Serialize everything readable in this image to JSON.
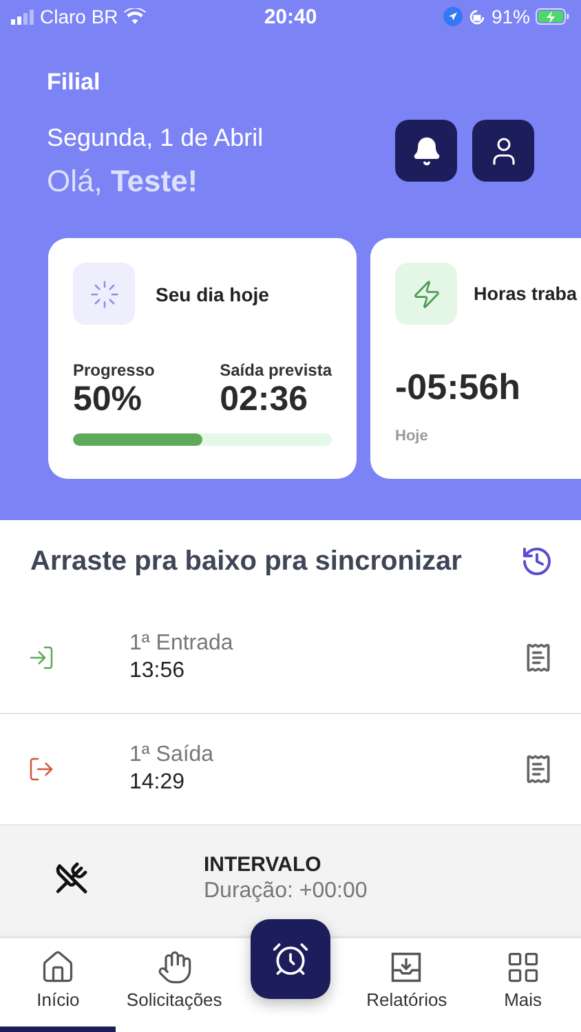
{
  "status_bar": {
    "carrier": "Claro BR",
    "time": "20:40",
    "battery": "91%"
  },
  "header": {
    "branch": "Filial",
    "date": "Segunda, 1 de Abril",
    "greeting": "Olá, **Teste!**"
  },
  "cards": [
    {
      "kind": "progress",
      "title": "Seu dia hoje",
      "progress_label": "Progresso",
      "progress_value": "50%",
      "exit_label": "Saída prevista",
      "exit_value": "02:36",
      "level": 0.5
    },
    {
      "kind": "hours",
      "title": "Horas traba",
      "value": "-05:56h",
      "caption": "Hoje"
    }
  ],
  "sync_title": "Arraste pra baixo pra sincronizar",
  "entries": [
    {
      "kind": "in",
      "label": "1ª Entrada",
      "time": "13:56"
    },
    {
      "kind": "out",
      "label": "1ª Saída",
      "time": "14:29"
    }
  ],
  "interval": {
    "title": "INTERVALO",
    "duration": "Duração: +00:00"
  },
  "nav": [
    {
      "kind": "home",
      "label": "Início",
      "selected": true
    },
    {
      "kind": "requests",
      "label": "Solicitações",
      "selected": false
    },
    {
      "kind": "clock",
      "selected": false
    },
    {
      "kind": "reports",
      "label": "Relatórios",
      "selected": false
    },
    {
      "kind": "more",
      "label": "Mais",
      "selected": false
    }
  ]
}
